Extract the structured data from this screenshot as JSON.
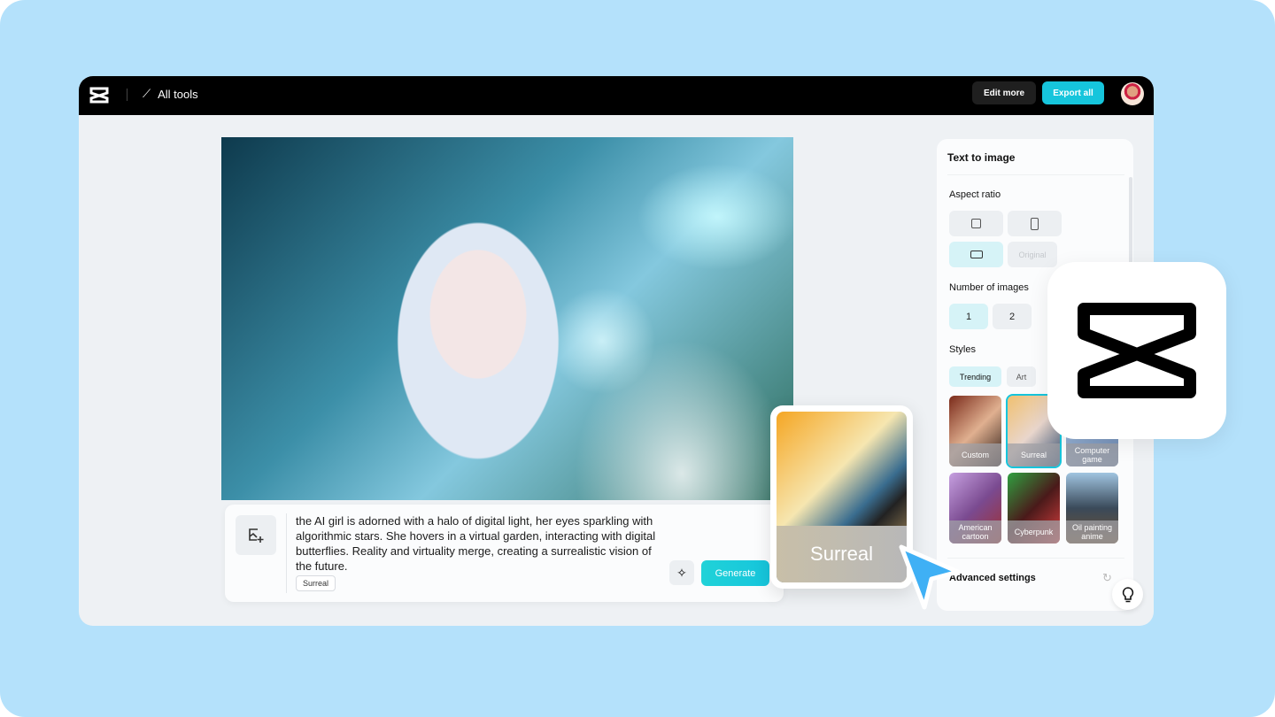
{
  "topbar": {
    "all_tools": "All tools",
    "edit_more": "Edit more",
    "export_all": "Export all"
  },
  "prompt": {
    "text": "the AI girl is adorned with a halo of digital light, her eyes sparkling with algorithmic stars. She hovers in a virtual garden, interacting with digital butterflies. Reality and virtuality merge, creating a surrealistic vision of the future.",
    "tag": "Surreal",
    "generate": "Generate"
  },
  "panel": {
    "title": "Text to image",
    "aspect_ratio": "Aspect ratio",
    "aspect_original": "Original",
    "number_of_images": "Number of images",
    "numbers": [
      "1",
      "2"
    ],
    "styles": "Styles",
    "style_tabs": [
      "Trending",
      "Art"
    ],
    "style_cards": [
      "Custom",
      "Surreal",
      "Computer game",
      "American cartoon",
      "Cyberpunk",
      "Oil painting anime"
    ],
    "advanced": "Advanced settings"
  },
  "popup": {
    "label": "Surreal"
  },
  "colors": {
    "accent": "#16c5dc",
    "background": "#b4e1fb",
    "cursor": "#3fb0f5"
  }
}
